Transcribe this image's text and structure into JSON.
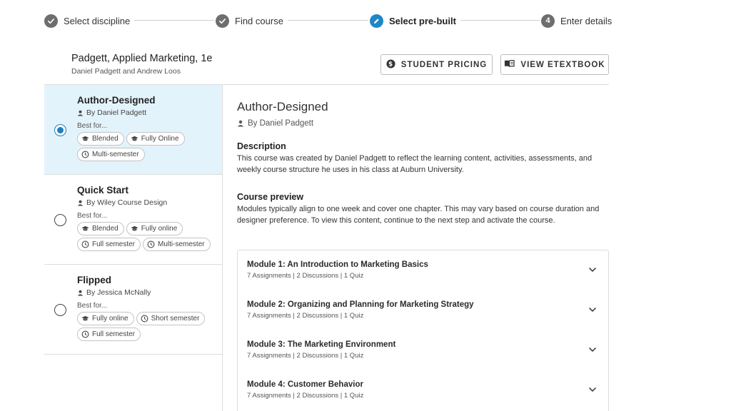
{
  "stepper": {
    "steps": [
      {
        "label": "Select discipline",
        "state": "done"
      },
      {
        "label": "Find course",
        "state": "done"
      },
      {
        "label": "Select pre-built",
        "state": "active"
      },
      {
        "label": "Enter details",
        "state": "todo",
        "number": "4"
      }
    ]
  },
  "course": {
    "title": "Padgett, Applied Marketing, 1e",
    "authors": "Daniel Padgett and Andrew Loos"
  },
  "buttons": {
    "student_pricing": "STUDENT PRICING",
    "view_etextbook": "VIEW ETEXTBOOK"
  },
  "options": [
    {
      "title": "Author-Designed",
      "author": "By Daniel Padgett",
      "best_for": "Best for...",
      "selected": true,
      "tags": [
        {
          "label": "Blended",
          "icon": "graduation-cap-icon"
        },
        {
          "label": "Fully Online",
          "icon": "graduation-cap-icon"
        },
        {
          "label": "Multi-semester",
          "icon": "clock-icon"
        }
      ]
    },
    {
      "title": "Quick Start",
      "author": "By Wiley Course Design",
      "best_for": "Best for...",
      "selected": false,
      "tags": [
        {
          "label": "Blended",
          "icon": "graduation-cap-icon"
        },
        {
          "label": "Fully online",
          "icon": "graduation-cap-icon"
        },
        {
          "label": "Full semester",
          "icon": "clock-icon"
        },
        {
          "label": "Multi-semester",
          "icon": "clock-icon"
        }
      ]
    },
    {
      "title": "Flipped",
      "author": "By Jessica McNally",
      "best_for": "Best for...",
      "selected": false,
      "tags": [
        {
          "label": "Fully online",
          "icon": "graduation-cap-icon"
        },
        {
          "label": "Short semester",
          "icon": "clock-icon"
        },
        {
          "label": "Full semester",
          "icon": "clock-icon"
        }
      ]
    }
  ],
  "detail": {
    "title": "Author-Designed",
    "author": "By Daniel Padgett",
    "description_heading": "Description",
    "description_text": "This course was created by Daniel Padgett to reflect the learning content, activities, assessments, and weekly course structure he uses in his class at Auburn University.",
    "preview_heading": "Course preview",
    "preview_text": "Modules typically align to one week and cover one chapter. This may vary based on course duration and designer preference. To view this content, continue to the next step and activate the course."
  },
  "modules": [
    {
      "title": "Module 1: An Introduction to Marketing Basics",
      "meta": "7 Assignments | 2 Discussions | 1 Quiz"
    },
    {
      "title": "Module 2: Organizing and Planning for Marketing Strategy",
      "meta": "7 Assignments | 2 Discussions | 1 Quiz"
    },
    {
      "title": "Module 3: The Marketing Environment",
      "meta": "7 Assignments | 2 Discussions | 1 Quiz"
    },
    {
      "title": "Module 4: Customer Behavior",
      "meta": "7 Assignments | 2 Discussions | 1 Quiz"
    }
  ],
  "colors": {
    "accent": "#1f86c8",
    "selected_bg": "#e3f3fb",
    "step_done": "#6e6e6e"
  }
}
